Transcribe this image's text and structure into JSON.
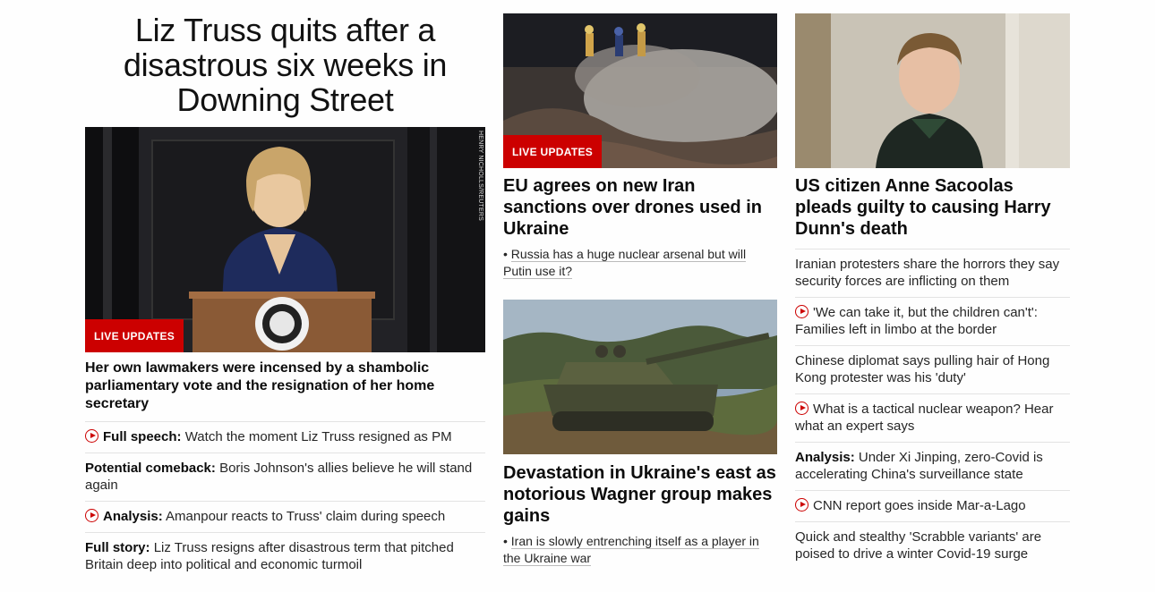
{
  "lead": {
    "title": "Liz Truss quits after a disastrous six weeks in Downing Street",
    "badge": "LIVE UPDATES",
    "photo_credit": "HENRY NICHOLLS/REUTERS",
    "headline": "Her own lawmakers were incensed by a shambolic parliamentary vote and the resignation of her home secretary",
    "items": [
      {
        "label": "Full speech:",
        "text": "Watch the moment Liz Truss resigned as PM",
        "video": true
      },
      {
        "label": "Potential comeback:",
        "text": "Boris Johnson's allies believe he will stand again",
        "video": false
      },
      {
        "label": "Analysis:",
        "text": "Amanpour reacts to Truss' claim during speech",
        "video": true
      },
      {
        "label": "Full story:",
        "text": "Liz Truss resigns after disastrous term that pitched Britain deep into political and economic turmoil",
        "video": false
      }
    ]
  },
  "middle": {
    "card1": {
      "badge": "LIVE UPDATES",
      "headline": "EU agrees on new Iran sanctions over drones used in Ukraine",
      "bullet": "Russia has a huge nuclear arsenal but will Putin use it?"
    },
    "card2": {
      "headline": "Devastation in Ukraine's east as notorious Wagner group makes gains",
      "bullet": "Iran is slowly entrenching itself as a player in the Ukraine war"
    }
  },
  "right": {
    "headline": "US citizen Anne Sacoolas pleads guilty to causing Harry Dunn's death",
    "items": [
      {
        "label": "",
        "text": "Iranian protesters share the horrors they say security forces are inflicting on them",
        "video": false
      },
      {
        "label": "",
        "text": "'We can take it, but the children can't': Families left in limbo at the border",
        "video": true
      },
      {
        "label": "",
        "text": "Chinese diplomat says pulling hair of Hong Kong protester was his 'duty'",
        "video": false
      },
      {
        "label": "",
        "text": "What is a tactical nuclear weapon? Hear what an expert says",
        "video": true
      },
      {
        "label": "Analysis:",
        "text": "Under Xi Jinping, zero-Covid is accelerating China's surveillance state",
        "video": false
      },
      {
        "label": "",
        "text": "CNN report goes inside Mar-a-Lago",
        "video": true
      },
      {
        "label": "",
        "text": "Quick and stealthy 'Scrabble variants' are poised to drive a winter Covid-19 surge",
        "video": false
      }
    ]
  },
  "colors": {
    "accent": "#cc0000",
    "text": "#0c0c0c",
    "divider": "#e3e3e3"
  }
}
